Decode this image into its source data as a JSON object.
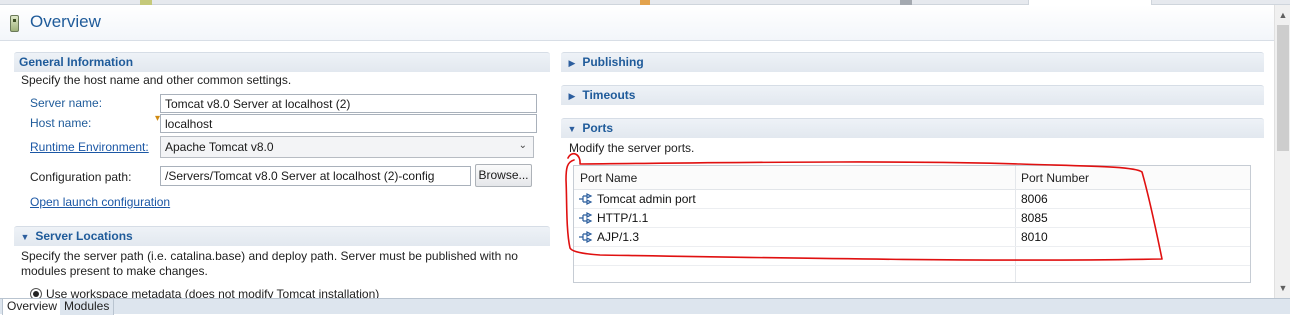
{
  "header": {
    "title": "Overview"
  },
  "general": {
    "title": "General Information",
    "description": "Specify the host name and other common settings.",
    "server_name_label": "Server name:",
    "server_name_value": "Tomcat v8.0 Server at localhost (2)",
    "host_name_label": "Host name:",
    "host_name_value": "localhost",
    "runtime_label": "Runtime Environment:",
    "runtime_value": "Apache Tomcat v8.0",
    "config_label": "Configuration path:",
    "config_value": "/Servers/Tomcat v8.0 Server at localhost (2)-config",
    "browse_label": "Browse...",
    "open_launch_label": "Open launch configuration"
  },
  "locations": {
    "title": "Server Locations",
    "description_line1": "Specify the server path (i.e. catalina.base) and deploy path. Server must be published with no",
    "description_line2": "modules present to make changes.",
    "option1": "Use workspace metadata (does not modify Tomcat installation)"
  },
  "publishing": {
    "title": "Publishing"
  },
  "timeouts": {
    "title": "Timeouts"
  },
  "ports": {
    "title": "Ports",
    "description": "Modify the server ports.",
    "columns": [
      "Port Name",
      "Port Number"
    ],
    "rows": [
      {
        "name": "Tomcat admin port",
        "number": "8006"
      },
      {
        "name": "HTTP/1.1",
        "number": "8085"
      },
      {
        "name": "AJP/1.3",
        "number": "8010"
      }
    ]
  },
  "bottom_tabs": [
    "Overview",
    "Modules"
  ],
  "colors": {
    "accent": "#1f5b9a",
    "annotation": "#e01010",
    "section_bg": "#e6ecf2"
  },
  "icons": {
    "header": "server-icon",
    "port": "port-connection-icon",
    "warning": "warning-decoration-icon"
  }
}
